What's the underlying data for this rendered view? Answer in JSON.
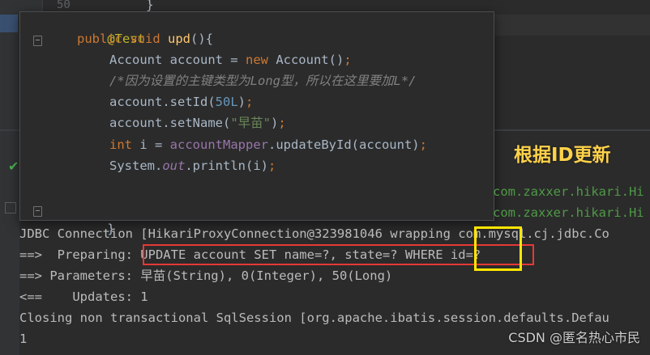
{
  "background": {
    "line_number": "50",
    "brace": "}"
  },
  "code": {
    "lines": [
      "@Test",
      "public void upd(){",
      "Account account = new Account();",
      "/*因为设置的主键类型为Long型，所以在这里要加L*/",
      "account.setId(50L);",
      "account.setName(\"早苗\");",
      "int i = accountMapper.updateById(account);",
      "System.out.println(i);",
      "",
      "}"
    ]
  },
  "heading": "根据ID更新",
  "log_right": [
    "com.zaxxer.hikari.Hi",
    "com.zaxxer.hikari.Hi"
  ],
  "console": {
    "lines": [
      "JDBC Connection [HikariProxyConnection@323981046 wrapping com.mysql.cj.jdbc.Co",
      "==>  Preparing: UPDATE account SET name=?, state=? WHERE id=?",
      "==> Parameters: 早苗(String), 0(Integer), 50(Long)",
      "<==    Updates: 1",
      "Closing non transactional SqlSession [org.apache.ibatis.session.defaults.Defau",
      "1"
    ]
  },
  "watermark": "CSDN @匿名热心市民",
  "colors": {
    "highlight_red": "#e53935",
    "highlight_yellow": "#ffe600",
    "heading": "#ffd24a"
  }
}
